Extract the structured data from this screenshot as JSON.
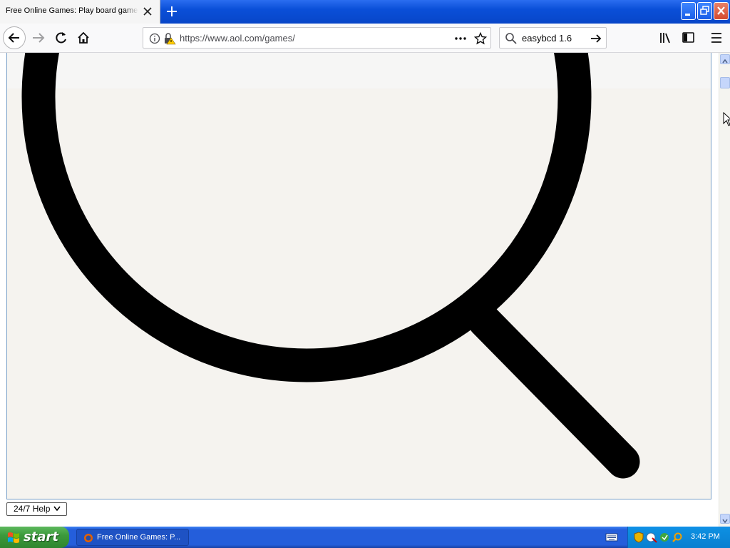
{
  "browser": {
    "tab_title": "Free Online Games: Play board games",
    "url": "https://www.aol.com/games/",
    "search_value": "easybcd 1.6"
  },
  "content": {
    "help_button_label": "24/7 Help"
  },
  "taskbar": {
    "start_label": "start",
    "task_label": "Free Online Games: P...",
    "clock": "3:42 PM"
  },
  "colors": {
    "titlebar_blue": "#0a4fd8",
    "taskbar_blue": "#245edb",
    "start_green": "#3c9a3c",
    "overlay_bg": "#f5f3ef"
  }
}
